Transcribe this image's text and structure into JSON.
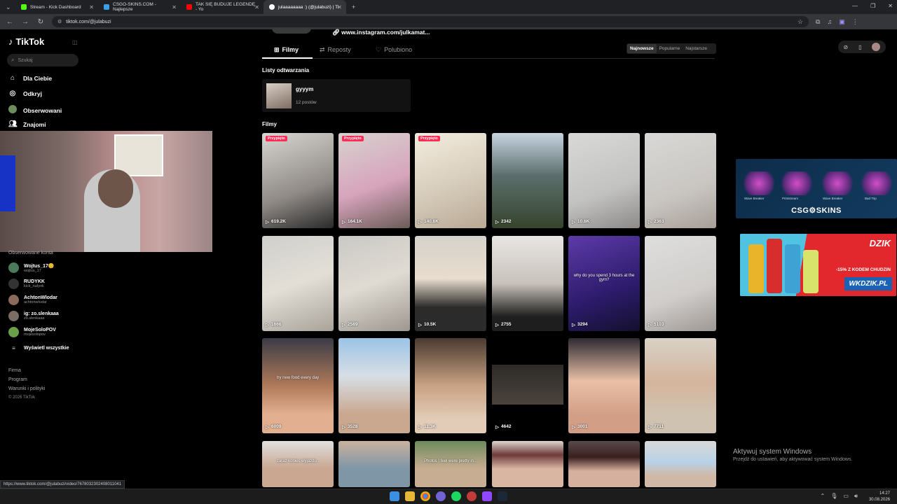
{
  "browser": {
    "tabs": [
      {
        "title": "Stream - Kick Dashboard",
        "color": "#53fc18"
      },
      {
        "title": "CSGO-SKINS.COM - Najlepsze",
        "color": "#3aa0e8"
      },
      {
        "title": "TAK SIĘ BUDUJE LEGENDĘ - Yo",
        "color": "#ff0000"
      },
      {
        "title": "julaaaaaaaa :) (@julabuzi) | Ti",
        "color": "#ffffff"
      }
    ],
    "url": "tiktok.com/@julabuzi"
  },
  "sidebar": {
    "logo": "TikTok",
    "search_placeholder": "Szukaj",
    "nav": [
      {
        "label": "Dla Ciebie",
        "icon": "home-icon"
      },
      {
        "label": "Odkryj",
        "icon": "compass-icon"
      },
      {
        "label": "Obserwowani",
        "icon": "following-avatar-icon"
      },
      {
        "label": "Znajomi",
        "icon": "friends-icon"
      }
    ],
    "following_header": "Obserwowane konta",
    "following": [
      {
        "name": "Wojtus_17😊",
        "handle": "wojtus_17"
      },
      {
        "name": "RUDYKK",
        "handle": "kick_rudyxk"
      },
      {
        "name": "AchtonWlodar",
        "handle": "achtonwlodar"
      },
      {
        "name": "ig: zo.slenkaaa",
        "handle": "zo.slenkaaa"
      },
      {
        "name": "MojeSoloPOV",
        "handle": "mojesolopov"
      }
    ],
    "show_all": "Wyświetl wszystkie",
    "footer": [
      "Firma",
      "Program",
      "Warunki i polityki",
      "© 2026 TikTok"
    ]
  },
  "profile": {
    "instagram_link": "www.instagram.com/julkamat...",
    "tabs": [
      "Filmy",
      "Reposty",
      "Polubiono"
    ],
    "sort": [
      "Najnowsze",
      "Popularne",
      "Najstarsze"
    ],
    "playlists_header": "Listy odtwarzania",
    "playlist": {
      "title": "gyyym",
      "count": "12 postów"
    },
    "videos_header": "Filmy",
    "pinned_label": "Przypięto",
    "videos": [
      {
        "views": "619.2K",
        "pinned": true,
        "caption": "",
        "bg": "linear-gradient(160deg,#d8d6d2,#8f8a86 60%,#2a2a2a)"
      },
      {
        "views": "164.1K",
        "pinned": true,
        "caption": "",
        "bg": "linear-gradient(160deg,#d7d2cf,#d7a4bc 55%,#6b5c58)"
      },
      {
        "views": "140.6K",
        "pinned": true,
        "caption": "",
        "bg": "linear-gradient(160deg,#f3ecde,#d9cfbe 50%,#b9a995)"
      },
      {
        "views": "2342",
        "pinned": false,
        "caption": "",
        "bg": "linear-gradient(180deg,#c7d4e2,#5b6e6b 45%,#36442d)"
      },
      {
        "views": "10.6K",
        "pinned": false,
        "caption": "",
        "bg": "linear-gradient(160deg,#d9d9d7,#c2c2c0 60%,#8d8a88)"
      },
      {
        "views": "2363",
        "pinned": false,
        "caption": "",
        "bg": "linear-gradient(160deg,#d8d8d6,#c9c6c2 60%,#a89f98)"
      },
      {
        "views": "1666",
        "pinned": false,
        "caption": "",
        "bg": "linear-gradient(160deg,#cfcfcd,#e3dfd6 50%,#a9a39a)"
      },
      {
        "views": "2589",
        "pinned": false,
        "caption": "",
        "bg": "linear-gradient(160deg,#cac9c6,#e0dbd2 50%,#9d978f)"
      },
      {
        "views": "10.5K",
        "pinned": false,
        "caption": "",
        "bg": "linear-gradient(180deg,#d6d2cc,#e8dccd 45%,#2b2b2b 75%)"
      },
      {
        "views": "2755",
        "pinned": false,
        "caption": "",
        "bg": "linear-gradient(180deg,#e8e6e3,#c8c2bb 50%,#1e1e1e 85%)"
      },
      {
        "views": "3294",
        "pinned": false,
        "caption": "why do you spend 3 hours at the gym?",
        "bg": "linear-gradient(160deg,#5d3aa8,#2c1b6b 60%,#14102e)"
      },
      {
        "views": "5103",
        "pinned": false,
        "caption": "",
        "bg": "linear-gradient(160deg,#dedede,#d0cdca 60%,#9e9894)"
      },
      {
        "views": "6009",
        "pinned": false,
        "caption": "try new food every day",
        "bg": "linear-gradient(180deg,#3a3b46,#b07a5a 50%,#e2b090 80%)"
      },
      {
        "views": "3528",
        "pinned": false,
        "caption": "",
        "bg": "linear-gradient(180deg,#9cc4e6,#d7dee5 40%,#c9a88f 80%)"
      },
      {
        "views": "11.3K",
        "pinned": false,
        "caption": "",
        "bg": "linear-gradient(180deg,#4a3a30,#c9a283 50%,#e2ccb7 85%)"
      },
      {
        "views": "4642",
        "pinned": false,
        "caption": "",
        "bg": "linear-gradient(180deg,#000 0%,#000 28%,#2d2a28 28%,#4b443d 70%,#000 70%)"
      },
      {
        "views": "3001",
        "pinned": false,
        "caption": "",
        "bg": "linear-gradient(180deg,#2e2a33,#e9c0a6 45%,#d39e86 80%)"
      },
      {
        "views": "7711",
        "pinned": false,
        "caption": "",
        "bg": "linear-gradient(180deg,#d8d2c6,#d5b59d 45%,#cfc2b0 80%)"
      },
      {
        "views": "",
        "pinned": false,
        "caption": "zaraz koniec wyjazdu..",
        "bg": "linear-gradient(180deg,#e0e0e0,#c9a791 60%)"
      },
      {
        "views": "",
        "pinned": false,
        "caption": "",
        "bg": "linear-gradient(180deg,#c8b29e,#7f96a6 60%)"
      },
      {
        "views": "",
        "pinned": false,
        "caption": "Photos I feel were pretty in...",
        "bg": "linear-gradient(180deg,#6d8a5b,#c7ad92 60%)"
      },
      {
        "views": "",
        "pinned": false,
        "caption": "",
        "bg": "linear-gradient(180deg,#ded6ce,#6e3a3a 30%,#d8b6a2 60%)"
      },
      {
        "views": "",
        "pinned": false,
        "caption": "",
        "bg": "linear-gradient(180deg,#5a4a4a,#3a2020 35%,#d6b09e 65%)"
      },
      {
        "views": "",
        "pinned": false,
        "caption": "",
        "bg": "linear-gradient(180deg,#d9d9d7,#b8d2e8 45%,#cfb9a6 75%)"
      }
    ]
  },
  "ads": {
    "csgo": {
      "brand": "CSG⚙SKINS",
      "items": [
        "Wave Breaker",
        "Printstream",
        "Wave Breaker",
        "Bad Trip"
      ]
    },
    "dzik": {
      "brand": "DZIK",
      "promo": "-15% Z KODEM CHUDZIN",
      "site": "WKDZIK.PL"
    }
  },
  "windows": {
    "activate_title": "Aktywuj system Windows",
    "activate_sub": "Przejdź do ustawień, aby aktywować system Windows.",
    "time": "14:27",
    "date": "30.08.2026"
  },
  "status_url": "https://www.tiktok.com/@julabuzi/video/7678032302408011041"
}
